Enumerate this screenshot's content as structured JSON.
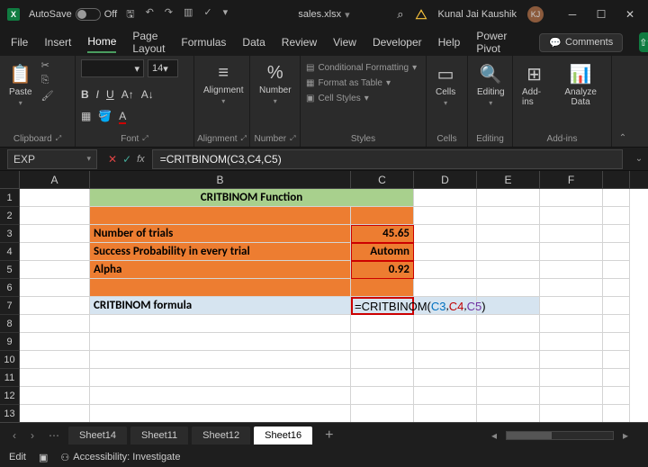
{
  "title_bar": {
    "autosave_label": "AutoSave",
    "autosave_state": "Off",
    "filename": "sales.xlsx",
    "search_icon": "search",
    "user_name": "Kunal Jai Kaushik",
    "user_initials": "KJ"
  },
  "menu": {
    "tabs": [
      "File",
      "Insert",
      "Home",
      "Page Layout",
      "Formulas",
      "Data",
      "Review",
      "View",
      "Developer",
      "Help",
      "Power Pivot"
    ],
    "active": "Home",
    "comments": "Comments"
  },
  "ribbon": {
    "clipboard": {
      "paste": "Paste",
      "label": "Clipboard"
    },
    "font": {
      "size": "14",
      "label": "Font",
      "bold": "B",
      "italic": "I",
      "underline": "U"
    },
    "alignment": {
      "label": "Alignment",
      "btn": "Alignment"
    },
    "number": {
      "label": "Number",
      "btn": "Number"
    },
    "styles": {
      "label": "Styles",
      "cond": "Conditional Formatting",
      "table": "Format as Table",
      "cell": "Cell Styles"
    },
    "cells": {
      "label": "Cells",
      "btn": "Cells"
    },
    "editing": {
      "label": "Editing",
      "btn": "Editing"
    },
    "addins": {
      "label": "Add-ins",
      "addins": "Add-ins",
      "analyze": "Analyze Data"
    }
  },
  "formula_bar": {
    "name_box": "EXP",
    "formula": "=CRITBINOM(C3,C4,C5)"
  },
  "grid": {
    "columns": [
      "A",
      "B",
      "C",
      "D",
      "E",
      "F"
    ],
    "r1": {
      "b": "CRITBINOM Function"
    },
    "r3": {
      "b": "Number of trials",
      "c": "45.65"
    },
    "r4": {
      "b": "Success Probability in every trial",
      "c": "Automn"
    },
    "r5": {
      "b": "Alpha",
      "c": "0.92"
    },
    "r7": {
      "b": "CRITBINOM formula",
      "c_prefix": "=CRITBINOM(",
      "c_r1": "C3",
      "c_r2": "C4",
      "c_r3": "C5",
      "c_suffix": ")"
    }
  },
  "sheets": {
    "tabs": [
      "Sheet14",
      "Sheet11",
      "Sheet12",
      "Sheet16"
    ],
    "active": "Sheet16"
  },
  "status": {
    "mode": "Edit",
    "accessibility": "Accessibility: Investigate"
  }
}
